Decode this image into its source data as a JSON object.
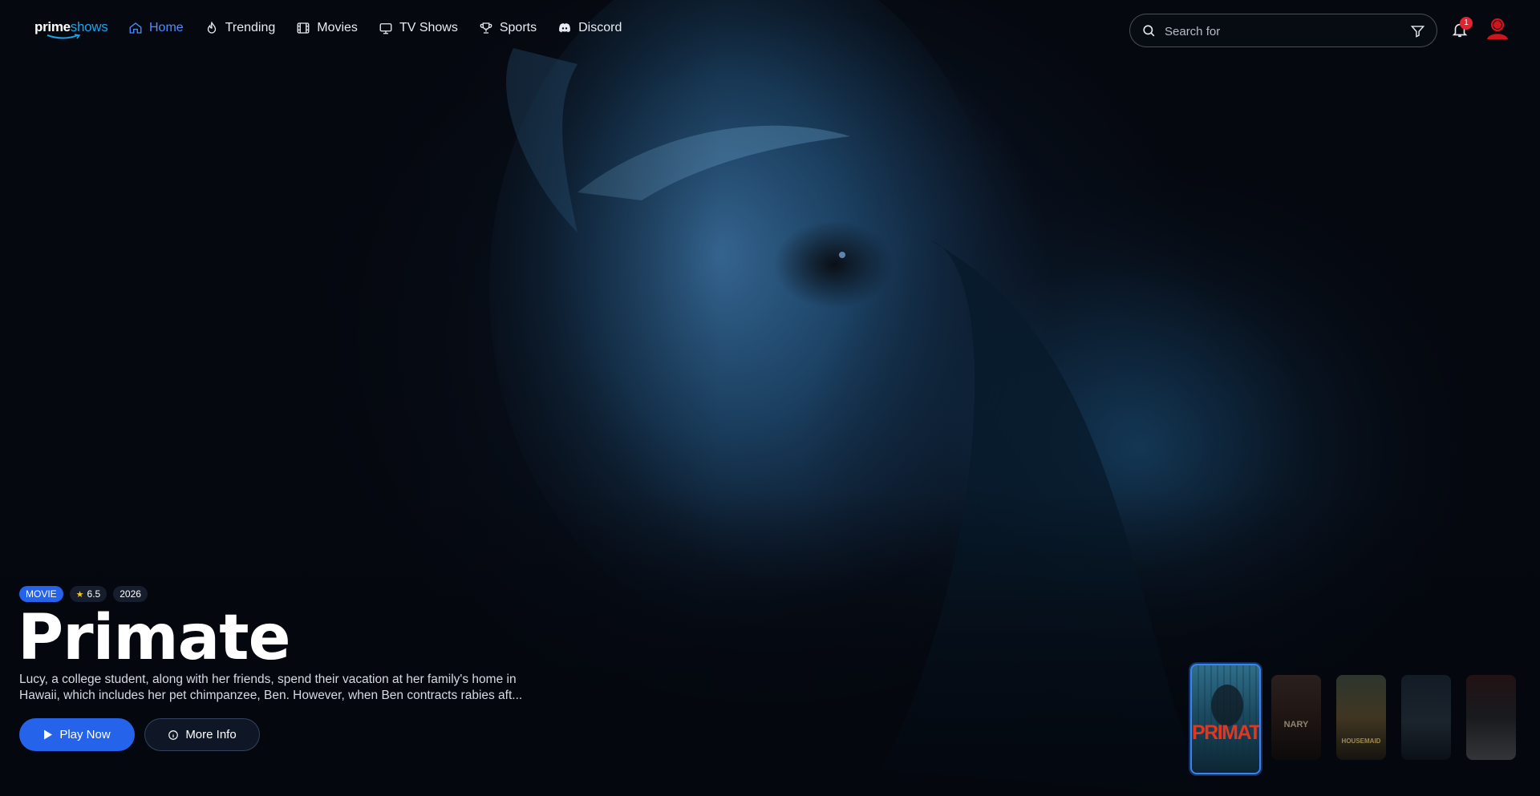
{
  "brand": {
    "prime": "prime",
    "shows": "shows"
  },
  "nav": {
    "items": [
      {
        "label": "Home",
        "icon": "home-icon",
        "active": true
      },
      {
        "label": "Trending",
        "icon": "flame-icon",
        "active": false
      },
      {
        "label": "Movies",
        "icon": "film-icon",
        "active": false
      },
      {
        "label": "TV Shows",
        "icon": "tv-icon",
        "active": false
      },
      {
        "label": "Sports",
        "icon": "trophy-icon",
        "active": false
      },
      {
        "label": "Discord",
        "icon": "discord-icon",
        "active": false
      }
    ]
  },
  "search": {
    "placeholder": "Search for",
    "value": ""
  },
  "notifications": {
    "count": "1"
  },
  "hero": {
    "type": "MOVIE",
    "rating": "6.5",
    "year": "2026",
    "title": "Primate",
    "description": "Lucy, a college student, along with her friends, spend their vacation at her family's home in Hawaii, which includes her pet chimpanzee, Ben. However, when Ben contracts rabies aft...",
    "play_label": "Play Now",
    "info_label": "More Info"
  },
  "thumbnails": [
    {
      "caption": "PRIMATE",
      "active": true
    },
    {
      "caption": "NARY",
      "active": false
    },
    {
      "caption": "HOUSEMAID",
      "active": false
    },
    {
      "caption": "",
      "active": false
    },
    {
      "caption": "",
      "active": false
    }
  ],
  "colors": {
    "accent": "#2563eb",
    "active_nav": "#4c8dff",
    "badge": "#e5232e",
    "avatar": "#d0161c"
  }
}
